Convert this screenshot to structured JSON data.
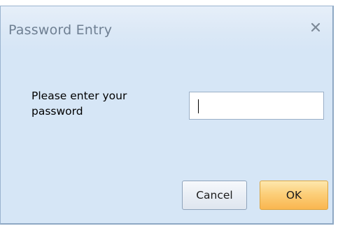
{
  "dialog": {
    "title": "Password Entry",
    "close_icon": "close-icon",
    "prompt": "Please enter your password",
    "password": {
      "value": "",
      "placeholder": ""
    },
    "buttons": {
      "cancel_label": "Cancel",
      "ok_label": "OK"
    }
  },
  "colors": {
    "body_background": "#d6e6f6",
    "title_text": "#6e7f92",
    "ok_button": "#fccf7a"
  }
}
